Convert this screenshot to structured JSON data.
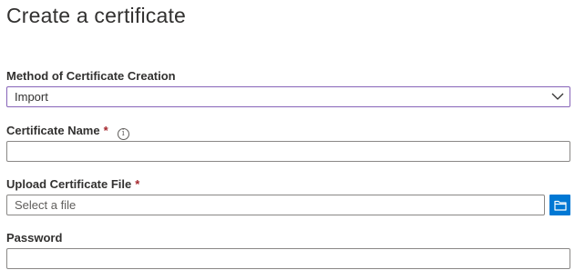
{
  "page": {
    "title": "Create a certificate"
  },
  "method": {
    "label": "Method of Certificate Creation",
    "selected": "Import",
    "icon": "chevron-down-icon"
  },
  "certificate_name": {
    "label": "Certificate Name",
    "required_marker": "*",
    "info_glyph": "i",
    "value": ""
  },
  "upload": {
    "label": "Upload Certificate File",
    "required_marker": "*",
    "placeholder": "Select a file",
    "button_icon": "folder-icon"
  },
  "password": {
    "label": "Password",
    "value": ""
  },
  "colors": {
    "accent": "#0078d4",
    "focus_border": "#8764b8",
    "required": "#a4262c"
  }
}
